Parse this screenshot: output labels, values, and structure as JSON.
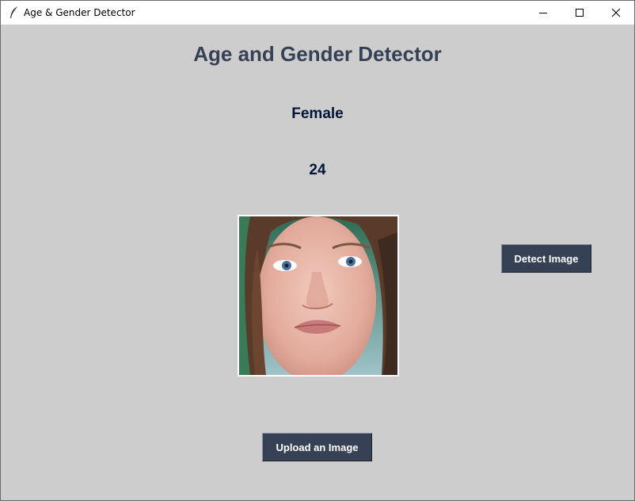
{
  "window": {
    "title": "Age & Gender Detector",
    "icon": "feather-icon",
    "controls": [
      "minimize-icon",
      "maximize-icon",
      "close-icon"
    ]
  },
  "main": {
    "heading": "Age and Gender Detector",
    "gender_result": "Female",
    "age_result": "24",
    "image": "uploaded-face-photo"
  },
  "buttons": {
    "detect_label": "Detect Image",
    "upload_label": "Upload an Image"
  },
  "colors": {
    "background": "#cdcdcd",
    "heading": "#364156",
    "result_text": "#011638",
    "button_bg": "#364156",
    "button_text": "#ffffff"
  }
}
